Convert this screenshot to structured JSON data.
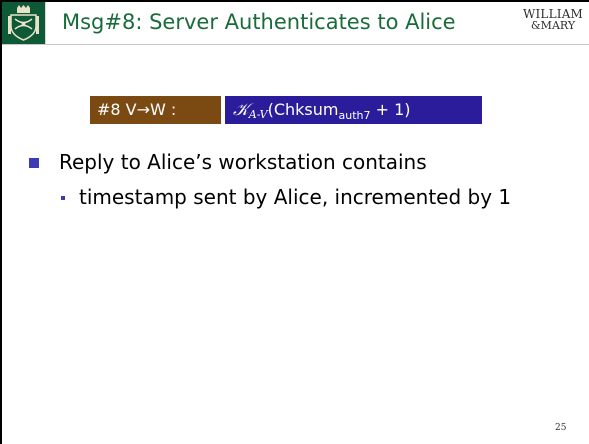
{
  "header": {
    "title": "Msg#8: Server Authenticates to Alice",
    "logo_line1": "WILLIAM",
    "logo_line2": "&MARY",
    "crest_color": "#0f5a36",
    "title_color": "#1a6b3a"
  },
  "message": {
    "label": "#8 V→W :",
    "key_symbol": "𝒦",
    "key_subscript": "A-V",
    "formula_open": "(Chksum",
    "formula_sub": "auth7",
    "formula_close": " + 1)",
    "label_bg": "#7a4a12",
    "formula_bg": "#2a1c9a"
  },
  "bullets": {
    "main": "Reply to Alice’s workstation contains",
    "sub": "timestamp sent by Alice, incremented by 1",
    "bullet_color": "#3b3bb3"
  },
  "footer": {
    "page_number": "25"
  }
}
